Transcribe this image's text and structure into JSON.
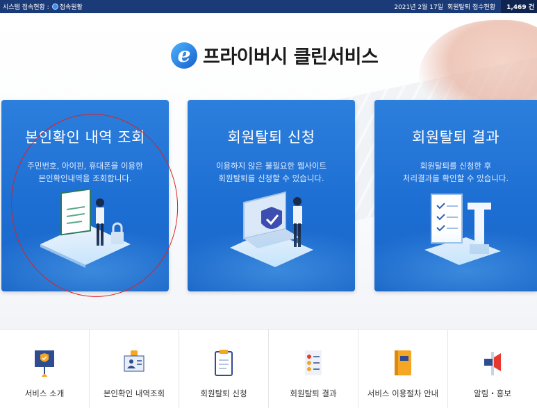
{
  "topbar": {
    "status_label": "시스템 접속현황 :",
    "status_value": "접속원활",
    "date": "2021년 2월 17일",
    "withdrawal_label": "회원탈퇴 접수현황",
    "withdrawal_count": "1,469 건"
  },
  "logo": {
    "mark": "e",
    "title": "프라이버시 클린서비스"
  },
  "cards": [
    {
      "title": "본인확인 내역 조회",
      "desc_line1": "주민번호, 아이핀, 휴대폰을 이용한",
      "desc_line2": "본인확인내역을 조회합니다."
    },
    {
      "title": "회원탈퇴 신청",
      "desc_line1": "이용하지 않은 불필요한 웹사이트",
      "desc_line2": "회원탈퇴를 신청할 수 있습니다."
    },
    {
      "title": "회원탈퇴 결과",
      "desc_line1": "회원탈퇴를 신청한 후",
      "desc_line2": "처리결과를 확인할 수 있습니다."
    }
  ],
  "menu": [
    {
      "label": "서비스 소개",
      "icon": "presentation-shield-icon"
    },
    {
      "label": "본인확인 내역조회",
      "icon": "id-card-icon"
    },
    {
      "label": "회원탈퇴 신청",
      "icon": "clipboard-icon"
    },
    {
      "label": "회원탈퇴 결과",
      "icon": "checklist-icon"
    },
    {
      "label": "서비스 이용절차 안내",
      "icon": "guide-book-icon"
    },
    {
      "label": "알림・홍보",
      "icon": "megaphone-icon"
    }
  ],
  "colors": {
    "topbar": "#1a3a78",
    "card_blue": "#1d6ed3",
    "annotation_red": "#e0201c"
  }
}
